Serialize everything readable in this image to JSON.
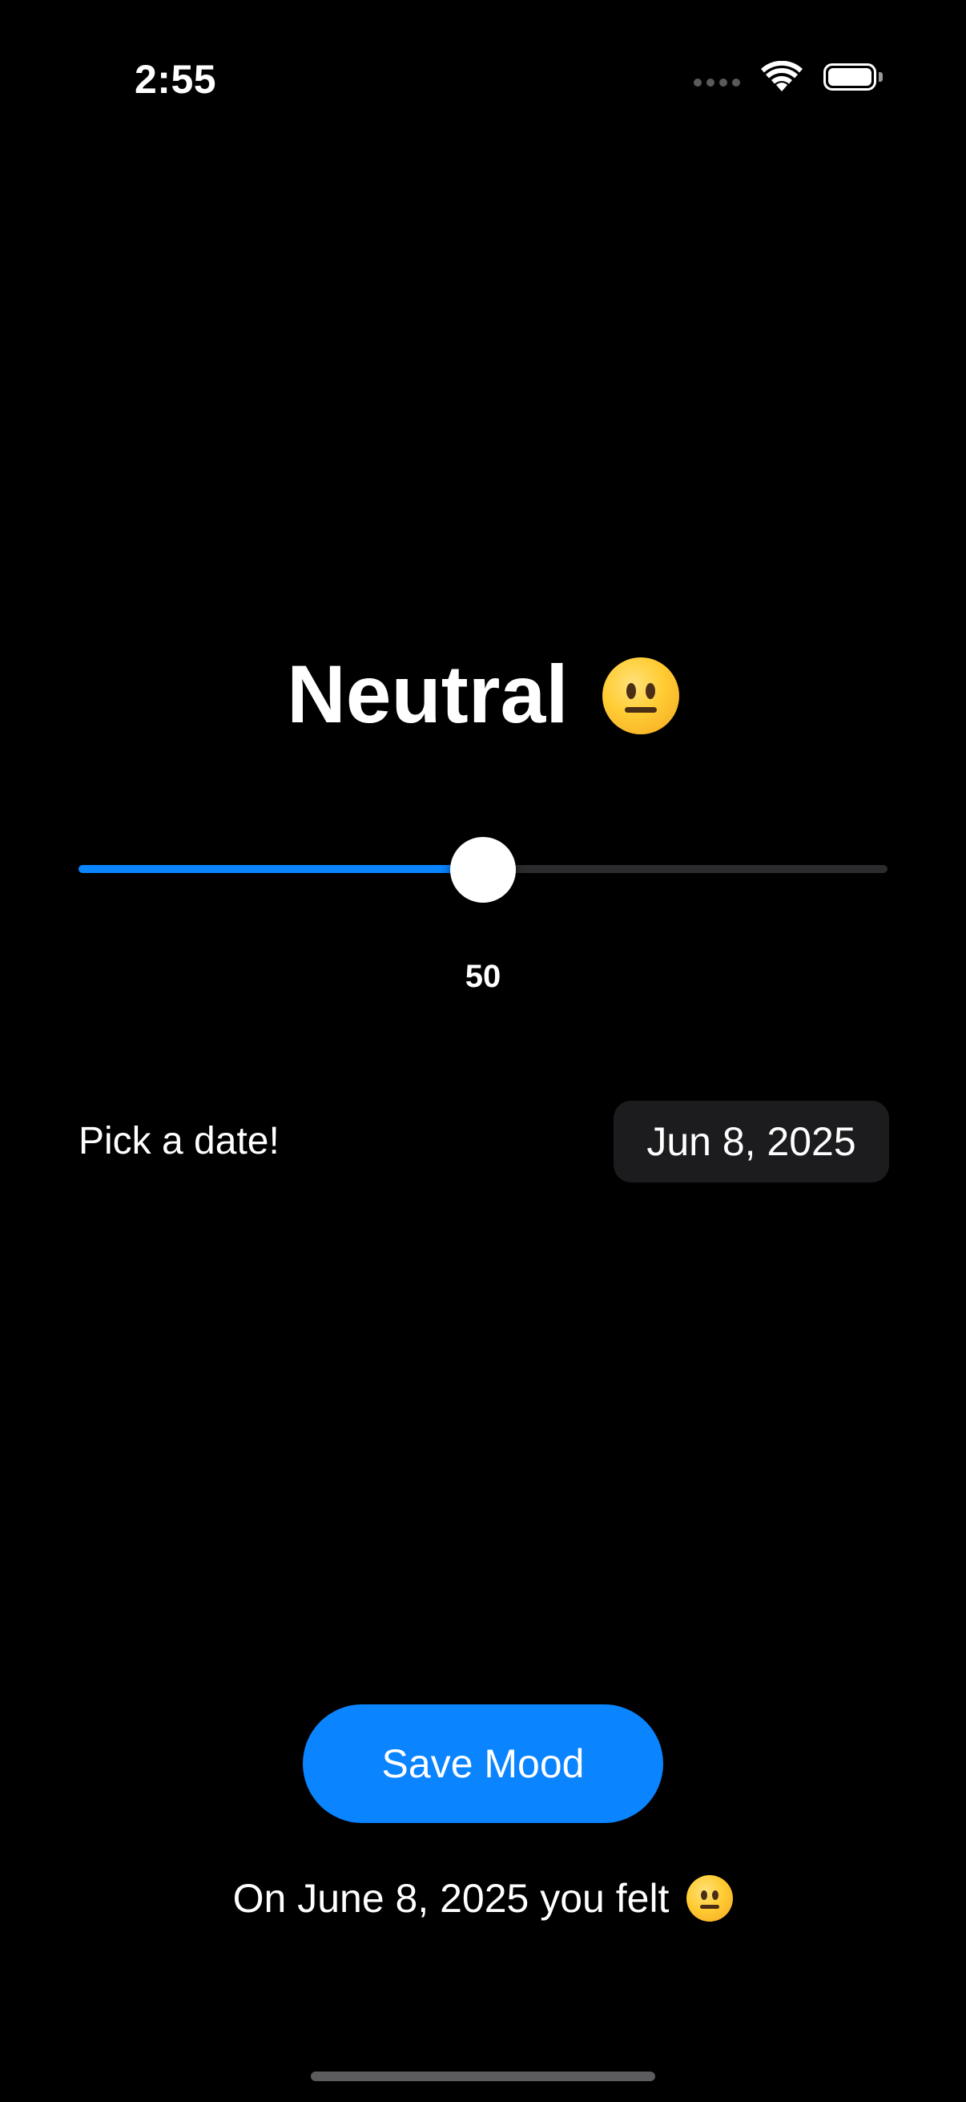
{
  "status_bar": {
    "time": "2:55",
    "signal_icon": "cellular-dots-icon",
    "wifi_icon": "wifi-icon",
    "battery_icon": "battery-icon",
    "battery_level": 1.0
  },
  "mood": {
    "title": "Neutral",
    "emoji_icon": "neutral-face-emoji",
    "slider_value": 50,
    "slider_min": 0,
    "slider_max": 100,
    "value_label": "50"
  },
  "date_picker": {
    "label": "Pick a date!",
    "value": "Jun 8, 2025"
  },
  "save_button": {
    "label": "Save Mood"
  },
  "result": {
    "text": "On June 8, 2025 you felt",
    "emoji_icon": "neutral-face-emoji"
  },
  "colors": {
    "background": "#000000",
    "accent": "#0a84ff",
    "track": "#2c2c2e",
    "date_pill": "#1c1c1e"
  }
}
